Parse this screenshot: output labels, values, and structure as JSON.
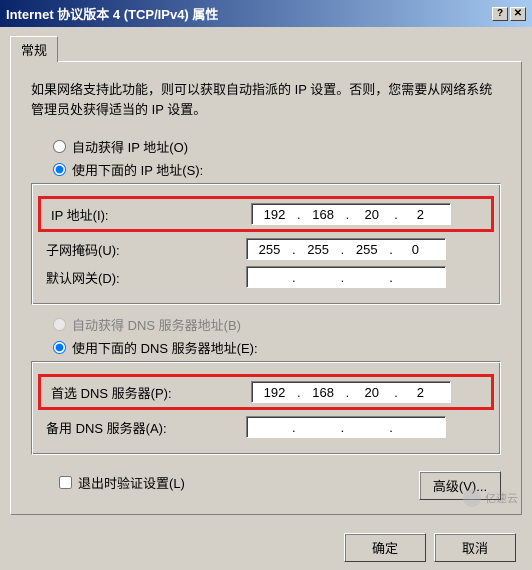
{
  "title": "Internet 协议版本 4 (TCP/IPv4) 属性",
  "tab_label": "常规",
  "intro_text": "如果网络支持此功能，则可以获取自动指派的 IP 设置。否则，您需要从网络系统管理员处获得适当的 IP 设置。",
  "ip_section": {
    "radio_auto": "自动获得 IP 地址(O)",
    "radio_manual": "使用下面的 IP 地址(S):",
    "selected": "manual",
    "fields": {
      "ip_label": "IP 地址(I):",
      "ip_value": [
        "192",
        "168",
        "20",
        "2"
      ],
      "mask_label": "子网掩码(U):",
      "mask_value": [
        "255",
        "255",
        "255",
        "0"
      ],
      "gateway_label": "默认网关(D):",
      "gateway_value": [
        "",
        "",
        "",
        ""
      ]
    }
  },
  "dns_section": {
    "radio_auto": "自动获得 DNS 服务器地址(B)",
    "radio_manual": "使用下面的 DNS 服务器地址(E):",
    "selected": "manual",
    "fields": {
      "primary_label": "首选 DNS 服务器(P):",
      "primary_value": [
        "192",
        "168",
        "20",
        "2"
      ],
      "alt_label": "备用 DNS 服务器(A):",
      "alt_value": [
        "",
        "",
        "",
        ""
      ]
    }
  },
  "validate_checkbox": "退出时验证设置(L)",
  "validate_checked": false,
  "advanced_button": "高级(V)...",
  "ok_button": "确定",
  "cancel_button": "取消",
  "watermark": "亿速云"
}
